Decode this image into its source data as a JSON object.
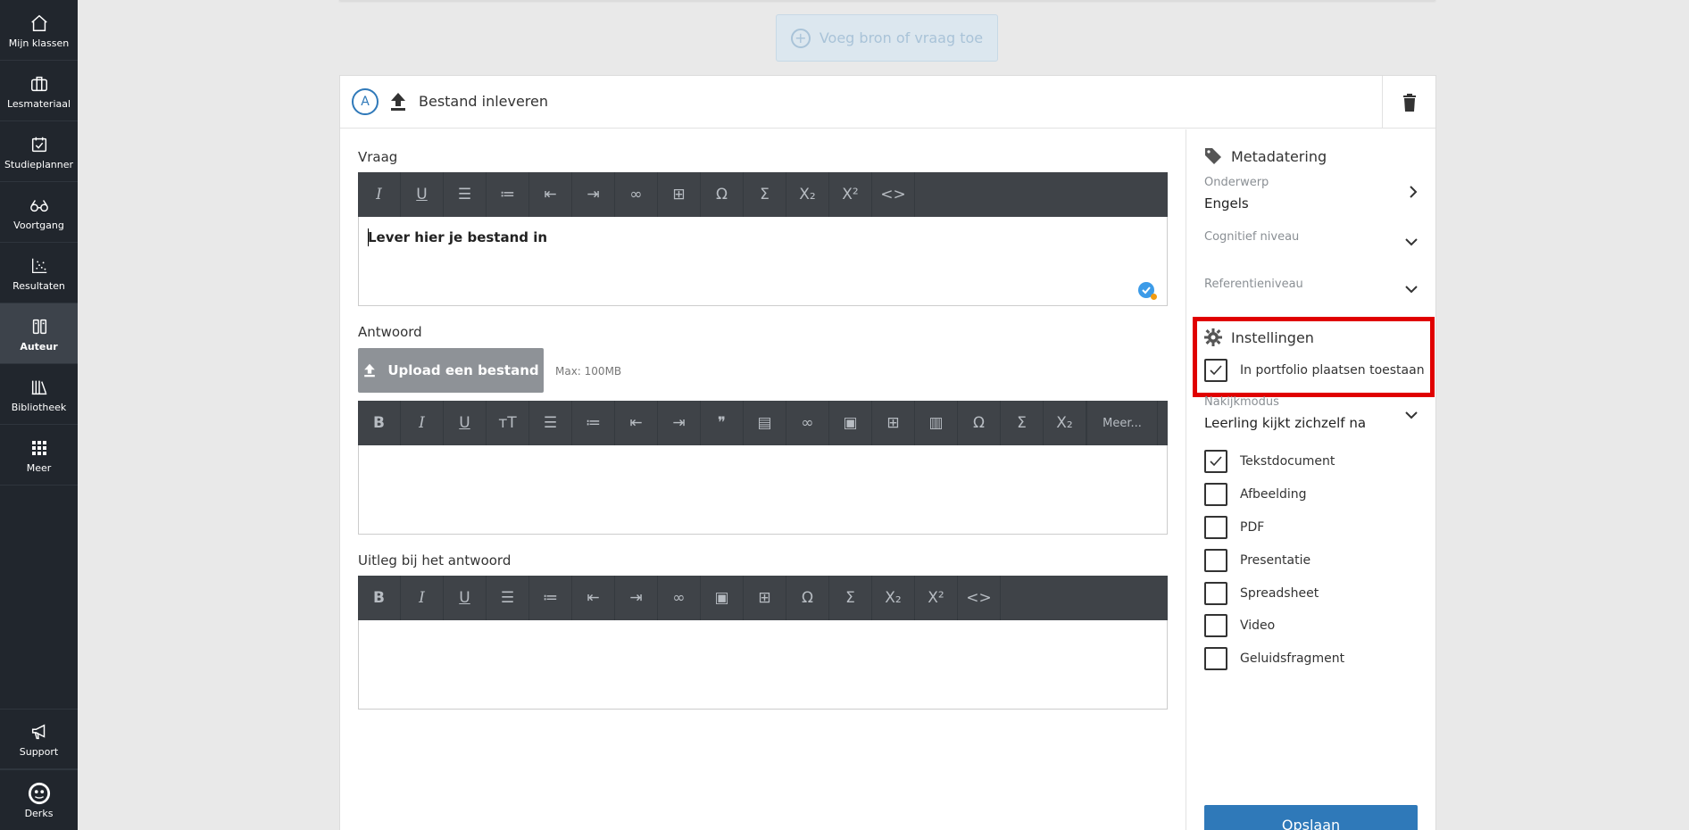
{
  "sidebar": {
    "items": [
      {
        "label": "Mijn klassen",
        "icon": "home-icon"
      },
      {
        "label": "Lesmateriaal",
        "icon": "briefcase-icon"
      },
      {
        "label": "Studieplanner",
        "icon": "calendar-check-icon"
      },
      {
        "label": "Voortgang",
        "icon": "glasses-icon"
      },
      {
        "label": "Resultaten",
        "icon": "scatter-chart-icon"
      },
      {
        "label": "Auteur",
        "icon": "author-icon",
        "active": true
      },
      {
        "label": "Bibliotheek",
        "icon": "library-icon"
      },
      {
        "label": "Meer",
        "icon": "grid-icon"
      }
    ],
    "support_label": "Support",
    "user_label": "Derks"
  },
  "add_button_label": "Voeg bron of vraag toe",
  "card": {
    "badge": "A",
    "title": "Bestand inleveren"
  },
  "question": {
    "label": "Vraag",
    "text": "Lever hier je bestand in"
  },
  "answer": {
    "label": "Antwoord",
    "upload_label": "Upload een bestand",
    "max_size": "Max: 100MB",
    "more_label": "Meer..."
  },
  "explanation": {
    "label": "Uitleg bij het antwoord"
  },
  "metadata": {
    "title": "Metadatering",
    "subject_label": "Onderwerp",
    "subject_value": "Engels",
    "cognitive_label": "Cognitief niveau",
    "reference_label": "Referentieniveau"
  },
  "settings": {
    "title": "Instellingen",
    "portfolio_label": "In portfolio plaatsen toestaan",
    "portfolio_checked": true,
    "grading_label": "Nakijkmodus",
    "grading_value": "Leerling kijkt zichzelf na"
  },
  "file_types": [
    {
      "label": "Tekstdocument",
      "checked": true
    },
    {
      "label": "Afbeelding",
      "checked": false
    },
    {
      "label": "PDF",
      "checked": false
    },
    {
      "label": "Presentatie",
      "checked": false
    },
    {
      "label": "Spreadsheet",
      "checked": false
    },
    {
      "label": "Video",
      "checked": false
    },
    {
      "label": "Geluidsfragment",
      "checked": false
    }
  ],
  "save_label": "Opslaan",
  "colors": {
    "sidebar_bg": "#21262d",
    "accent": "#2f79b9",
    "highlight": "#e00000"
  }
}
